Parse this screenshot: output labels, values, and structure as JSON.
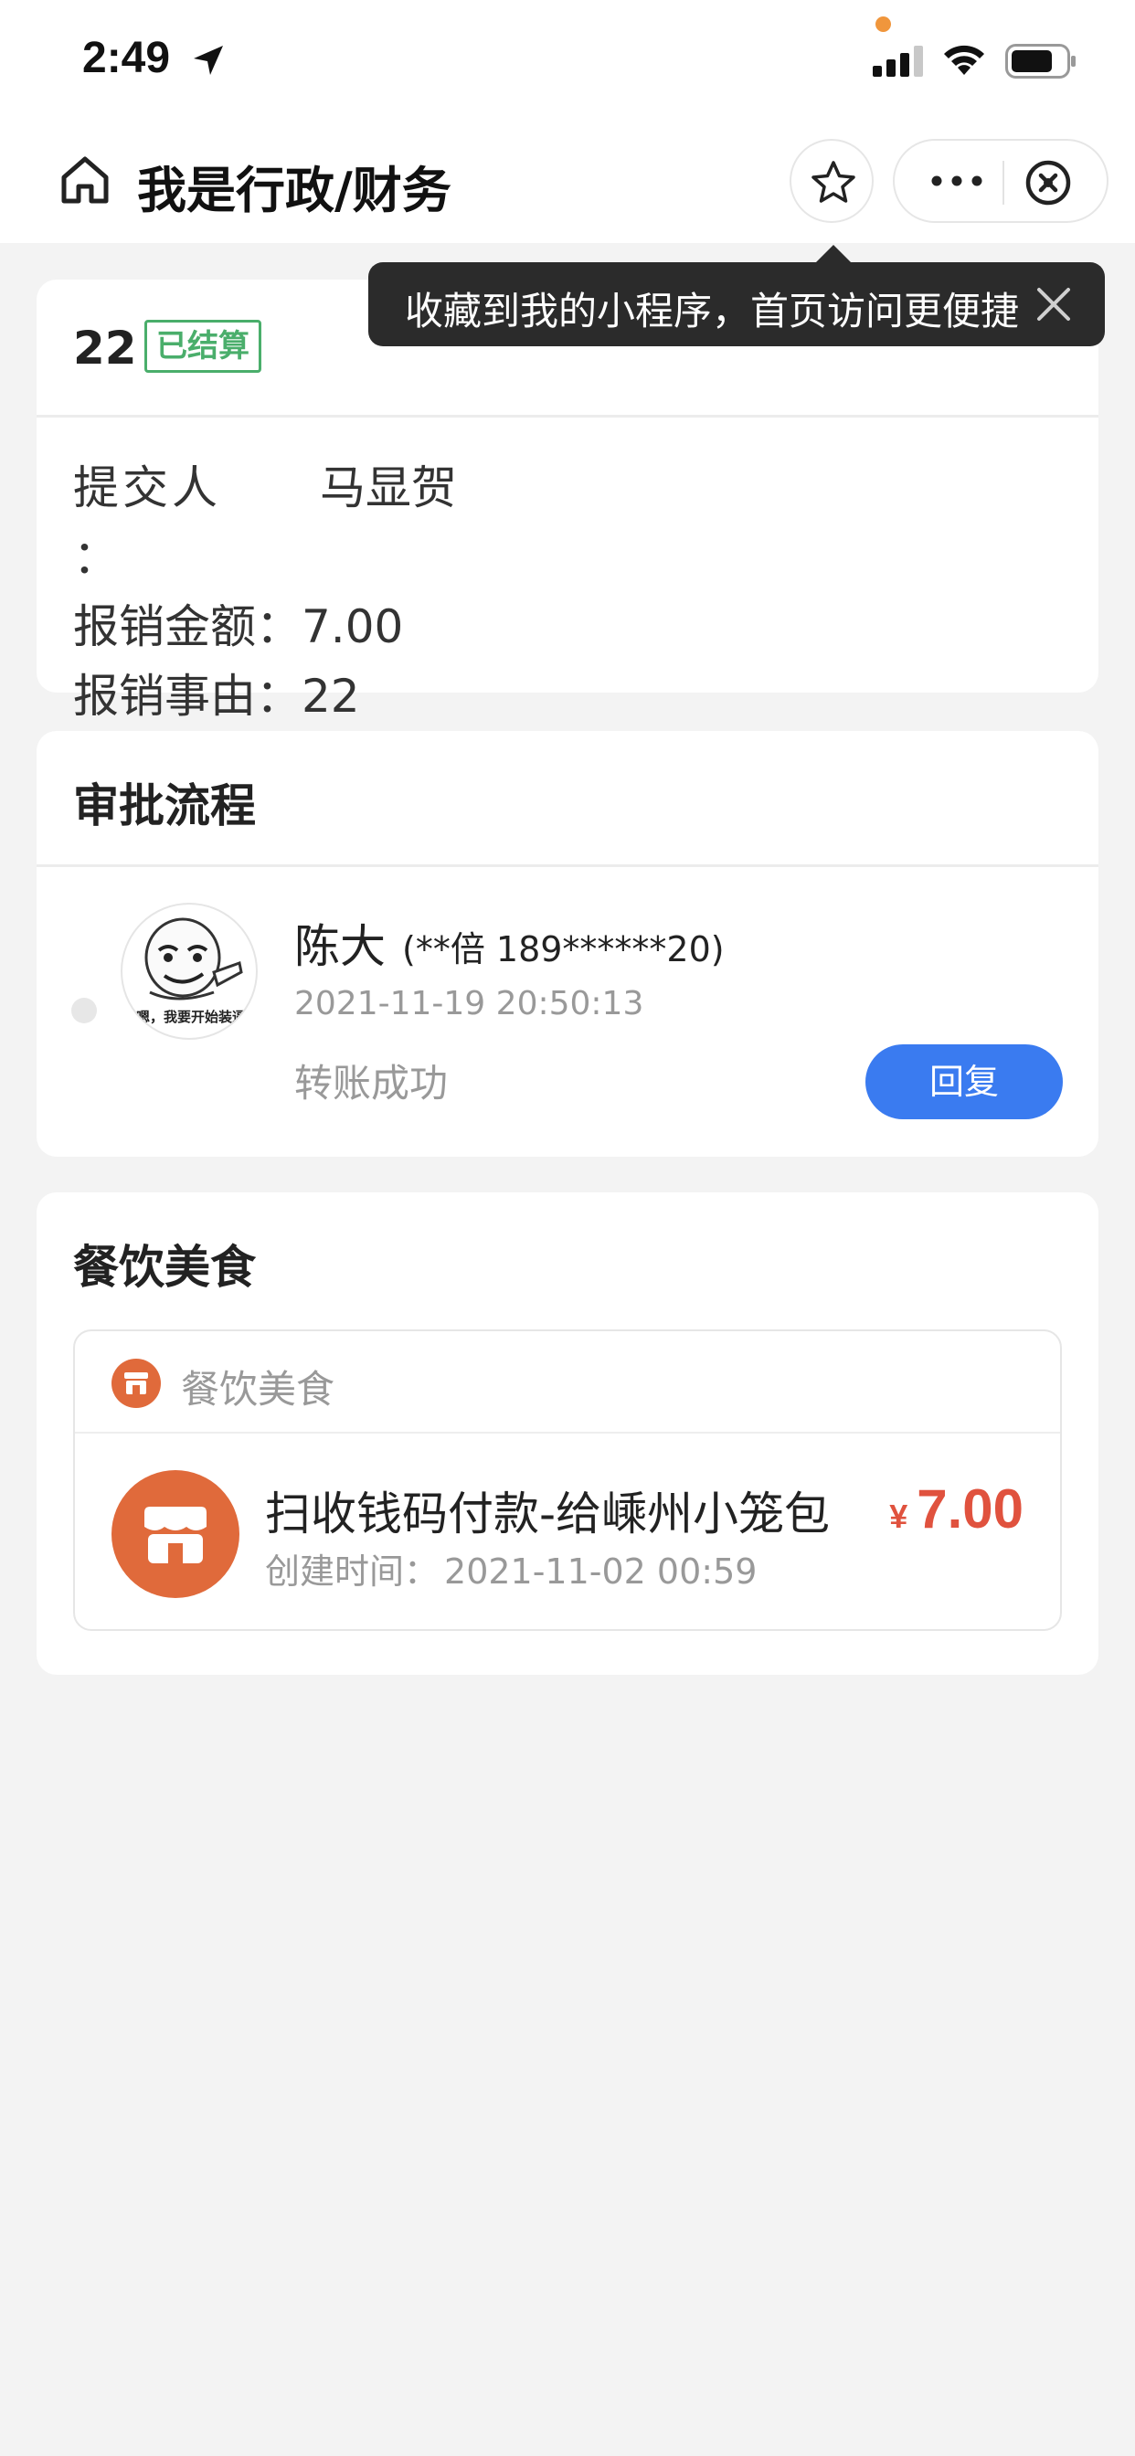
{
  "status_bar": {
    "time": "2:49"
  },
  "nav": {
    "title": "我是行政/财务"
  },
  "tooltip": {
    "text": "收藏到我的小程序，首页访问更便捷"
  },
  "record": {
    "number": "22",
    "status_badge": "已结算",
    "status_color": "#4aae6b",
    "fields": [
      {
        "label": "提交人",
        "colon": "：",
        "value": "马显贺"
      },
      {
        "label": "报销金额",
        "colon": "：",
        "value": "7.00"
      },
      {
        "label": "报销事由",
        "colon": "：",
        "value": "22"
      }
    ]
  },
  "approval": {
    "title": "审批流程",
    "approver": {
      "name": "陈大",
      "phone": "(**倍 189******20)",
      "time": "2021-11-19 20:50:13",
      "status": "转账成功",
      "avatar_caption": "嗯，我要开始装逼"
    },
    "reply_label": "回复",
    "reply_color": "#3a7bf0"
  },
  "expense": {
    "title": "餐饮美食",
    "category": "餐饮美食",
    "category_color": "#e06a3b",
    "item": {
      "title": "扫收钱码付款-给嵊州小笼包",
      "created_label": "创建时间：",
      "created_value": "2021-11-02 00:59",
      "currency": "¥",
      "amount": "7.00"
    }
  },
  "icons": [
    "location-arrow-icon",
    "signal-icon",
    "wifi-icon",
    "battery-icon",
    "home-icon",
    "star-icon",
    "more-icon",
    "close-circle-icon",
    "close-icon",
    "shop-icon"
  ]
}
